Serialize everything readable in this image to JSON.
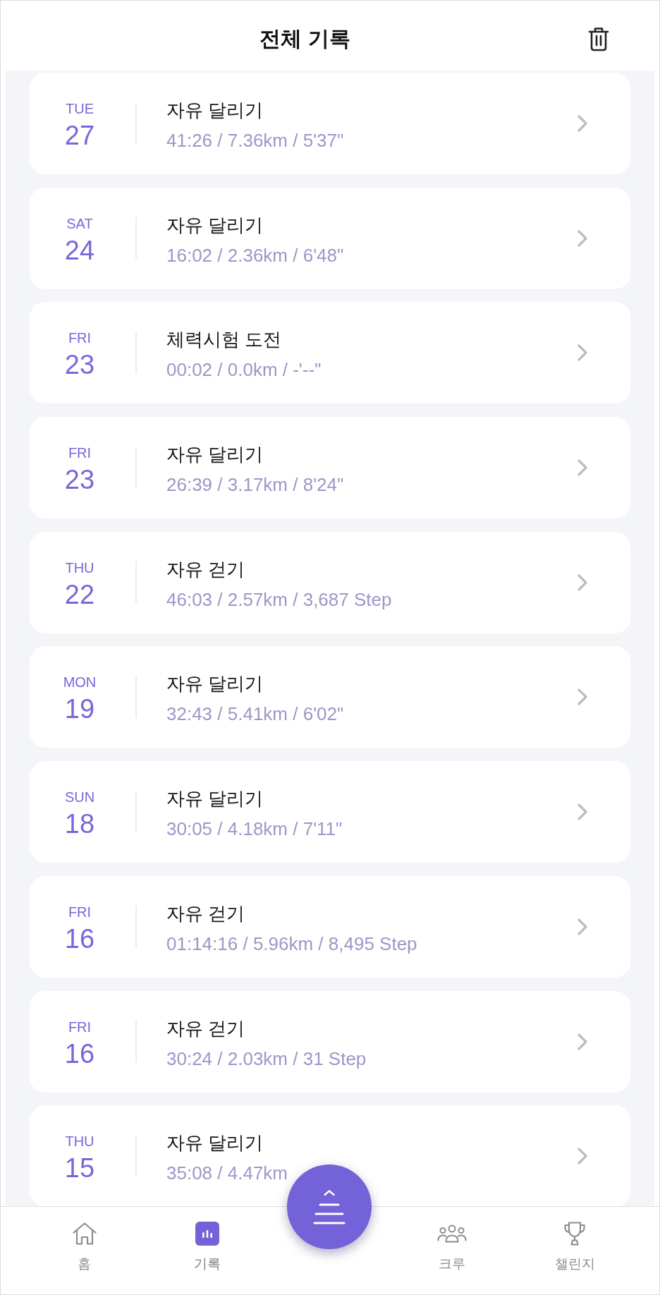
{
  "header": {
    "title": "전체 기록"
  },
  "records": [
    {
      "weekday": "TUE",
      "day": "27",
      "title": "자유 달리기",
      "stats": "41:26 / 7.36km / 5'37\""
    },
    {
      "weekday": "SAT",
      "day": "24",
      "title": "자유 달리기",
      "stats": "16:02 / 2.36km / 6'48\""
    },
    {
      "weekday": "FRI",
      "day": "23",
      "title": "체력시험 도전",
      "stats": "00:02 / 0.0km / -'--\""
    },
    {
      "weekday": "FRI",
      "day": "23",
      "title": "자유 달리기",
      "stats": "26:39 / 3.17km / 8'24\""
    },
    {
      "weekday": "THU",
      "day": "22",
      "title": "자유 걷기",
      "stats": "46:03 / 2.57km / 3,687 Step"
    },
    {
      "weekday": "MON",
      "day": "19",
      "title": "자유 달리기",
      "stats": "32:43 / 5.41km / 6'02\""
    },
    {
      "weekday": "SUN",
      "day": "18",
      "title": "자유 달리기",
      "stats": "30:05 / 4.18km / 7'11\""
    },
    {
      "weekday": "FRI",
      "day": "16",
      "title": "자유 걷기",
      "stats": "01:14:16 / 5.96km / 8,495 Step"
    },
    {
      "weekday": "FRI",
      "day": "16",
      "title": "자유 걷기",
      "stats": "30:24 / 2.03km / 31 Step"
    },
    {
      "weekday": "THU",
      "day": "15",
      "title": "자유 달리기",
      "stats": "35:08 / 4.47km"
    }
  ],
  "nav": {
    "items": [
      {
        "kind": "home",
        "label": "홈",
        "selected": false
      },
      {
        "kind": "records",
        "label": "기록",
        "selected": true
      },
      {
        "kind": "crew",
        "label": "크루",
        "selected": false
      },
      {
        "kind": "challenge",
        "label": "챌린지",
        "selected": false
      }
    ]
  }
}
